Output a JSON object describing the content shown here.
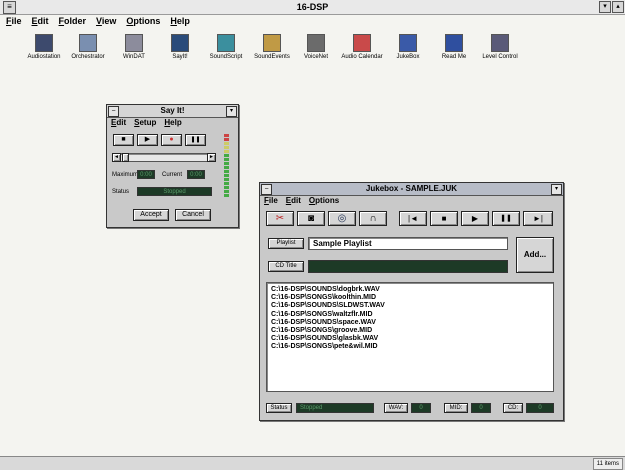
{
  "main_window": {
    "title": "16-DSP",
    "menu": [
      "File",
      "Edit",
      "Folder",
      "View",
      "Options",
      "Help"
    ],
    "apps": [
      {
        "label": "Audiostation",
        "icon": "audiostation-icon",
        "color": "#3d4a6d"
      },
      {
        "label": "Orchestrator",
        "icon": "orchestrator-icon",
        "color": "#7a8fb0"
      },
      {
        "label": "WinDAT",
        "icon": "windat-icon",
        "color": "#8c8c9c"
      },
      {
        "label": "SayIt!",
        "icon": "sayit-icon",
        "color": "#2a4b7a"
      },
      {
        "label": "SoundScript",
        "icon": "soundscript-icon",
        "color": "#3b8f9e"
      },
      {
        "label": "SoundEvents",
        "icon": "soundevents-icon",
        "color": "#c09a45"
      },
      {
        "label": "VoiceNet",
        "icon": "voicenet-icon",
        "color": "#6b6b6b"
      },
      {
        "label": "Audio Calendar",
        "icon": "audio-calendar-icon",
        "color": "#c94a4a"
      },
      {
        "label": "JukeBox",
        "icon": "jukebox-icon",
        "color": "#3a5aa8"
      },
      {
        "label": "Read Me",
        "icon": "read-me-icon",
        "color": "#2f4f9f"
      },
      {
        "label": "Level Control",
        "icon": "level-control-icon",
        "color": "#5a5a78"
      }
    ],
    "status_count": "11 items"
  },
  "sayit": {
    "title": "Say It!",
    "menu": [
      "Edit",
      "Setup",
      "Help"
    ],
    "transport": {
      "stop": "■",
      "play": "▶",
      "record": "●",
      "pause": "❚❚"
    },
    "scroll_left": "◄",
    "scroll_right": "►",
    "maximum_label": "Maximum",
    "maximum_value": "0:00",
    "current_label": "Current",
    "current_value": "0:00",
    "status_label": "Status",
    "status_value": "Stopped",
    "accept": "Accept",
    "cancel": "Cancel"
  },
  "jukebox": {
    "title": "Jukebox - SAMPLE.JUK",
    "menu": [
      "File",
      "Edit",
      "Options"
    ],
    "tools": {
      "cut": "✂",
      "camera": "◙",
      "cd": "◎",
      "headphones": "∩"
    },
    "transport": {
      "prev": "|◄",
      "stop": "■",
      "play": "▶",
      "pause": "❚❚",
      "next": "►|"
    },
    "playlist_label": "Playlist",
    "playlist_value": "Sample Playlist",
    "cdtitle_label": "CD Title",
    "add_button": "Add...",
    "files": [
      "C:\\16-DSP\\SOUNDS\\dogbrk.WAV",
      "C:\\16-DSP\\SONGS\\koolthin.MID",
      "C:\\16-DSP\\SOUNDS\\SLDWST.WAV",
      "C:\\16-DSP\\SONGS\\waltzflr.MID",
      "C:\\16-DSP\\SOUNDS\\space.WAV",
      "C:\\16-DSP\\SONGS\\groove.MID",
      "C:\\16-DSP\\SOUNDS\\glasbk.WAV",
      "C:\\16-DSP\\SONGS\\pete&wil.MID"
    ],
    "status_label": "Status",
    "status_value": "Stopped",
    "wav_label": "WAV:",
    "wav_value": "0",
    "mid_label": "MID:",
    "mid_value": "0",
    "cd_label": "CD:",
    "cd_value": "0"
  },
  "colors": {
    "lcd_bg": "#1d3a26",
    "lcd_text": "#5a9b6a",
    "titlebar_active": "#b7bcc7",
    "face": "#c9c9c9"
  }
}
